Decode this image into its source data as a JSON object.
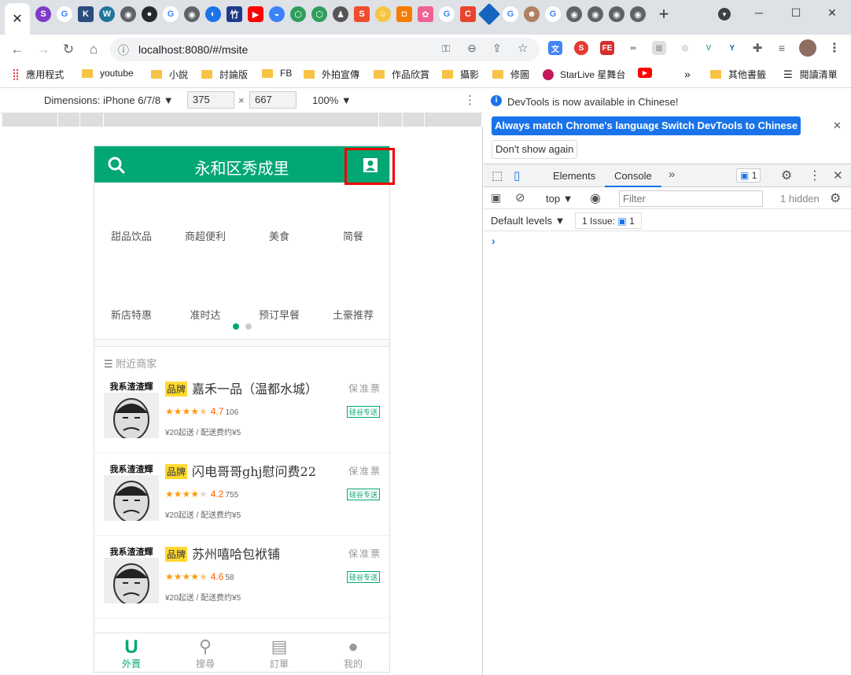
{
  "browser": {
    "address": "localhost:8080/#/msite",
    "bookmarks": [
      "應用程式",
      "youtube",
      "小說",
      "討論版",
      "FB",
      "外拍宣傳",
      "作品欣賞",
      "攝影",
      "修圖",
      "StarLive 星舞台",
      "其他書籤",
      "閱讀清單"
    ],
    "new_tab": "+"
  },
  "device": {
    "label": "Dimensions: iPhone 6/7/8 ▼",
    "width": "375",
    "height": "667",
    "times": "×",
    "zoom": "100% ▼"
  },
  "app": {
    "title": "永和区秀成里",
    "categories": [
      "甜品饮品",
      "商超便利",
      "美食",
      "简餐",
      "新店特惠",
      "准时达",
      "预订早餐",
      "土豪推荐"
    ],
    "section_title": "附近商家",
    "brand_label": "品牌",
    "guarantee": "保准票",
    "tag_label": "硅谷专送",
    "shops": [
      {
        "name": "嘉禾一品（温都水城）",
        "stars": 4.5,
        "rating": "4.7",
        "count": "106",
        "fee": "¥20起送 / 配送费约¥5",
        "img_text": "我系渣渣輝"
      },
      {
        "name": "闪电哥哥ghj慰问费22",
        "stars": 4,
        "rating": "4.2",
        "count": "755",
        "fee": "¥20起送 / 配送费约¥5",
        "img_text": "我系渣渣輝"
      },
      {
        "name": "苏州嘻哈包袱铺",
        "stars": 4.5,
        "rating": "4.6",
        "count": "58",
        "fee": "¥20起送 / 配送费约¥5",
        "img_text": "我系渣渣輝"
      }
    ],
    "footer": [
      "外賣",
      "搜尋",
      "訂單",
      "我的"
    ]
  },
  "devtools": {
    "notice": "DevTools is now available in Chinese!",
    "btn_match": "Always match Chrome's language",
    "btn_switch": "Switch DevTools to Chinese",
    "btn_dont": "Don't show again",
    "tab_elements": "Elements",
    "tab_console": "Console",
    "msg_count": "1",
    "context": "top ▼",
    "filter_placeholder": "Filter",
    "hidden": "1 hidden",
    "levels": "Default levels ▼",
    "issue": "1 Issue:",
    "issue_count": "1",
    "prompt": "›"
  },
  "colors": {
    "brand": "#02a774",
    "highlight": "#ee0000"
  }
}
